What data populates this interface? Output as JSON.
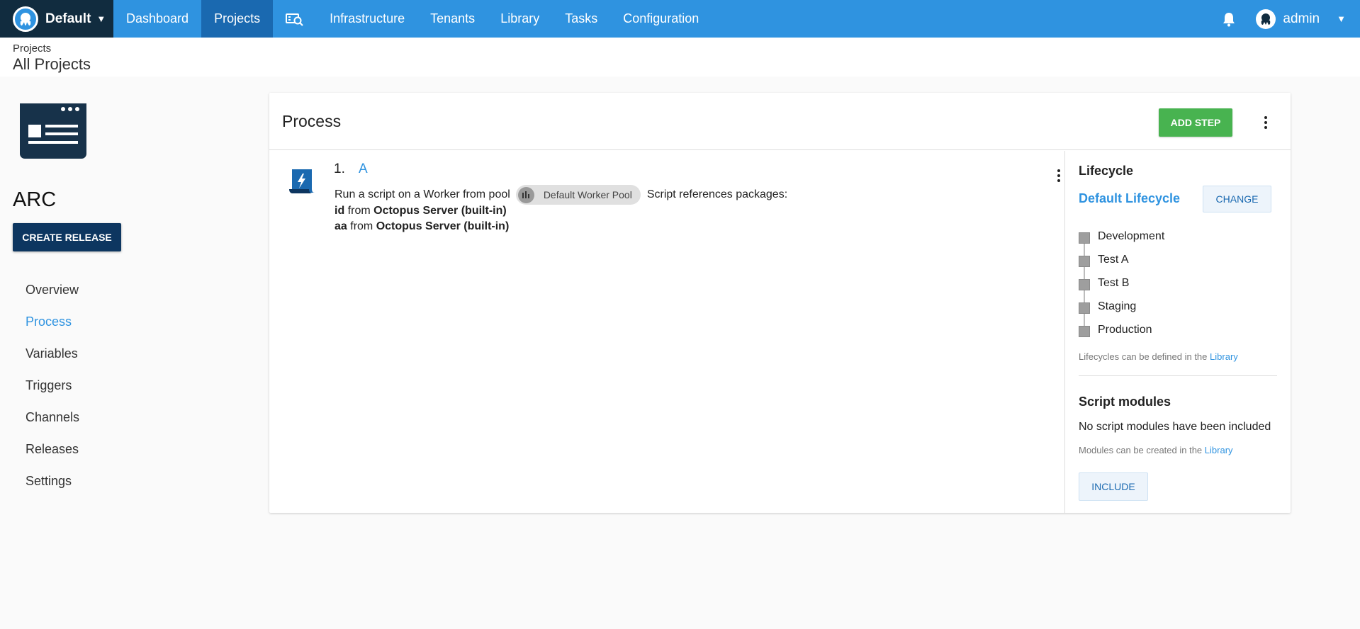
{
  "topnav": {
    "space": "Default",
    "items": [
      {
        "label": "Dashboard",
        "active": false
      },
      {
        "label": "Projects",
        "active": true
      },
      {
        "label": "",
        "icon": "search-machines-icon"
      },
      {
        "label": "Infrastructure",
        "active": false
      },
      {
        "label": "Tenants",
        "active": false
      },
      {
        "label": "Library",
        "active": false
      },
      {
        "label": "Tasks",
        "active": false
      },
      {
        "label": "Configuration",
        "active": false
      }
    ],
    "user": "admin"
  },
  "header": {
    "breadcrumb": "Projects",
    "title": "All Projects"
  },
  "sidebar": {
    "project_name": "ARC",
    "create_release": "CREATE RELEASE",
    "items": [
      {
        "label": "Overview"
      },
      {
        "label": "Process",
        "active": true
      },
      {
        "label": "Variables"
      },
      {
        "label": "Triggers"
      },
      {
        "label": "Channels"
      },
      {
        "label": "Releases"
      },
      {
        "label": "Settings"
      }
    ]
  },
  "process": {
    "title": "Process",
    "add_step": "ADD STEP",
    "step": {
      "number": "1.",
      "name": "A",
      "desc_prefix": "Run a script on a Worker from pool",
      "pool": "Default Worker Pool",
      "desc_suffix": "Script references packages:",
      "packages": [
        {
          "id": "id",
          "from": "from",
          "feed": "Octopus Server (built-in)"
        },
        {
          "id": "aa",
          "from": "from",
          "feed": "Octopus Server (built-in)"
        }
      ]
    }
  },
  "lifecycle": {
    "heading": "Lifecycle",
    "name": "Default Lifecycle",
    "change": "CHANGE",
    "phases": [
      "Development",
      "Test A",
      "Test B",
      "Staging",
      "Production"
    ],
    "note": "Lifecycles can be defined in the",
    "note_link": "Library"
  },
  "script_modules": {
    "heading": "Script modules",
    "none": "No script modules have been included",
    "note": "Modules can be created in the",
    "note_link": "Library",
    "include": "INCLUDE"
  },
  "colors": {
    "nav": "#2f93e0",
    "nav_active": "#1a69b0",
    "brand_dark": "#112c3f",
    "add_step": "#48b350",
    "create_release": "#0d3660"
  }
}
